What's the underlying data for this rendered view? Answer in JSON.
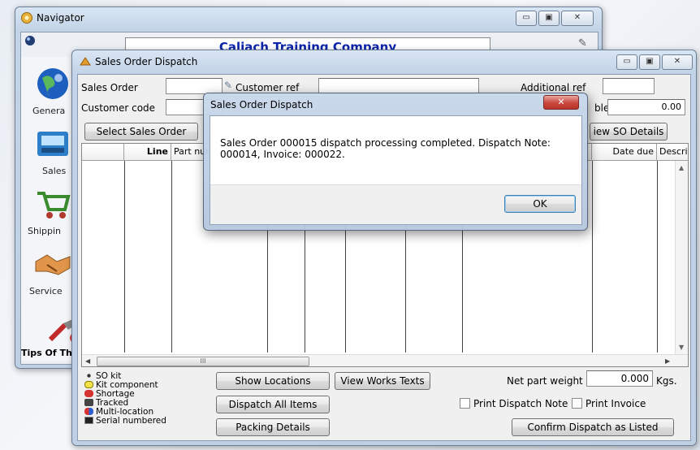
{
  "navigator": {
    "title": "Navigator",
    "company": "Caliach Training Company",
    "sidebar": [
      {
        "label": "Genera"
      },
      {
        "label": "Sales"
      },
      {
        "label": "Shippin"
      },
      {
        "label": "Service"
      }
    ],
    "tips": "Tips Of Th"
  },
  "sod": {
    "title": "Sales Order Dispatch",
    "sales_order_label": "Sales Order",
    "customer_ref_label": "Customer ref",
    "additional_ref_label": "Additional ref",
    "customer_code_label": "Customer code",
    "partial_label": "ble",
    "total_value": "0.00",
    "select_button": "Select Sales Order",
    "view_button": "iew SO Details",
    "columns": [
      "Line",
      "Part nur",
      "Date due",
      "Descrip"
    ],
    "hscroll_grip": "III",
    "legend": [
      "SO kit",
      "Kit component",
      "Shortage",
      "Tracked",
      "Multi-location",
      "Serial numbered"
    ],
    "buttons": {
      "show_locations": "Show Locations",
      "view_works_texts": "View Works Texts",
      "dispatch_all": "Dispatch All Items",
      "packing_details": "Packing Details",
      "confirm": "Confirm Dispatch as Listed"
    },
    "net_weight_label": "Net part weight",
    "net_weight_value": "0.000",
    "net_weight_unit": "Kgs.",
    "print_dispatch_note": "Print Dispatch Note",
    "print_invoice": "Print Invoice"
  },
  "dialog": {
    "title": "Sales Order Dispatch",
    "message": "Sales Order 000015 dispatch processing completed. Dispatch Note: 000014, Invoice: 000022.",
    "ok": "OK",
    "close": "✕"
  },
  "colors": {
    "company_text": "#0b24a8",
    "close_button": "#c9463d"
  }
}
